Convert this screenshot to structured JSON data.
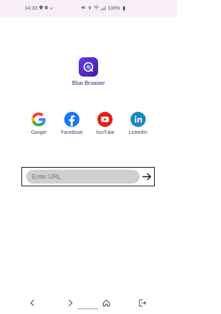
{
  "status_bar": {
    "time": "14:33",
    "battery_text": "100%",
    "icons": [
      "location-icon",
      "settings-icon",
      "dropdown-icon",
      "mute-icon",
      "volte-icon",
      "wifi-icon",
      "signal-icon",
      "battery-icon"
    ]
  },
  "app": {
    "name": "Blue Browser",
    "logo_icon": "blue-browser-logo-icon",
    "colors": {
      "brand": "#5a2ed6",
      "text": "#1e2c6e"
    }
  },
  "shortcuts": [
    {
      "label": "Google",
      "icon": "google-icon"
    },
    {
      "label": "FaceBook",
      "icon": "facebook-icon"
    },
    {
      "label": "YouTube",
      "icon": "youtube-icon"
    },
    {
      "label": "LinkedIn",
      "icon": "linkedin-icon"
    }
  ],
  "url_bar": {
    "placeholder": "Enter URL",
    "value": "",
    "go_icon": "arrow-right-icon"
  },
  "nav": {
    "items": [
      "back-icon",
      "forward-icon",
      "home-icon",
      "exit-icon"
    ]
  }
}
